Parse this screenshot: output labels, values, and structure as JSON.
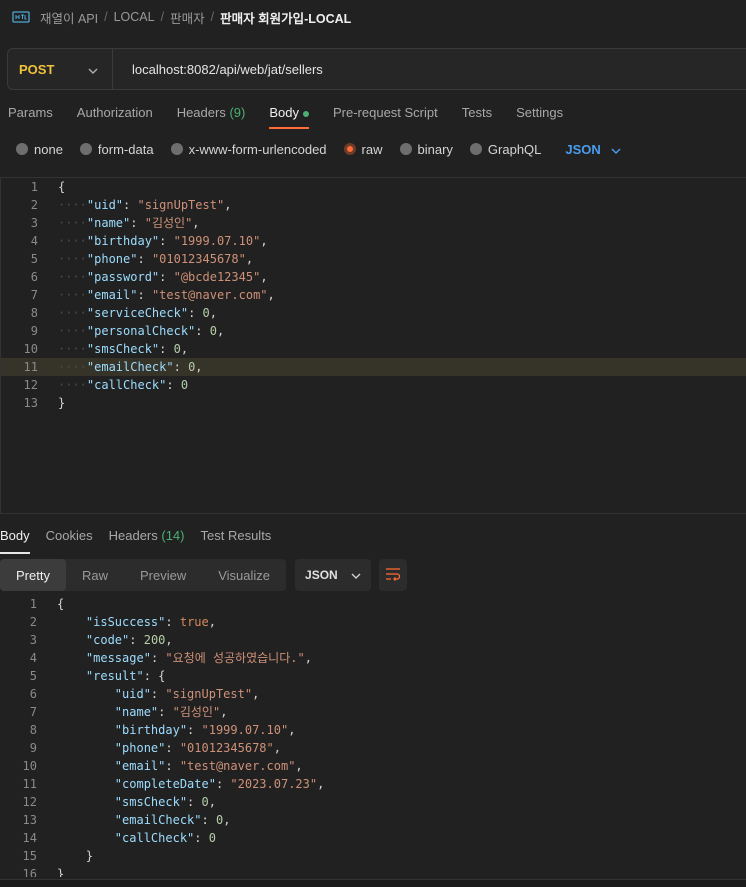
{
  "breadcrumb": {
    "parts": [
      "재열이 API",
      "LOCAL",
      "판매자"
    ],
    "separator": "/",
    "current": "판매자 회원가입-LOCAL"
  },
  "request": {
    "method": "POST",
    "url": "localhost:8082/api/web/jat/sellers"
  },
  "request_tabs": {
    "params": "Params",
    "authorization": "Authorization",
    "headers": "Headers",
    "headers_count": "(9)",
    "body": "Body",
    "prerequest": "Pre-request Script",
    "tests": "Tests",
    "settings": "Settings"
  },
  "body_types": {
    "none": "none",
    "form_data": "form-data",
    "urlencoded": "x-www-form-urlencoded",
    "raw": "raw",
    "binary": "binary",
    "graphql": "GraphQL",
    "language": "JSON"
  },
  "request_body": {
    "lines": [
      {
        "n": "1",
        "t": [
          [
            "p",
            "{"
          ]
        ]
      },
      {
        "n": "2",
        "t": [
          [
            "ws",
            "····"
          ],
          [
            "k",
            "\"uid\""
          ],
          [
            "p",
            ": "
          ],
          [
            "s",
            "\"signUpTest\""
          ],
          [
            "p",
            ","
          ]
        ]
      },
      {
        "n": "3",
        "t": [
          [
            "ws",
            "····"
          ],
          [
            "k",
            "\"name\""
          ],
          [
            "p",
            ": "
          ],
          [
            "s",
            "\"김성인\""
          ],
          [
            "p",
            ","
          ]
        ]
      },
      {
        "n": "4",
        "t": [
          [
            "ws",
            "····"
          ],
          [
            "k",
            "\"birthday\""
          ],
          [
            "p",
            ": "
          ],
          [
            "s",
            "\"1999.07.10\""
          ],
          [
            "p",
            ","
          ]
        ]
      },
      {
        "n": "5",
        "t": [
          [
            "ws",
            "····"
          ],
          [
            "k",
            "\"phone\""
          ],
          [
            "p",
            ": "
          ],
          [
            "s",
            "\"01012345678\""
          ],
          [
            "p",
            ","
          ]
        ]
      },
      {
        "n": "6",
        "t": [
          [
            "ws",
            "····"
          ],
          [
            "k",
            "\"password\""
          ],
          [
            "p",
            ": "
          ],
          [
            "s",
            "\"@bcde12345\""
          ],
          [
            "p",
            ","
          ]
        ]
      },
      {
        "n": "7",
        "t": [
          [
            "ws",
            "····"
          ],
          [
            "k",
            "\"email\""
          ],
          [
            "p",
            ": "
          ],
          [
            "s",
            "\"test@naver.com\""
          ],
          [
            "p",
            ","
          ]
        ]
      },
      {
        "n": "8",
        "t": [
          [
            "ws",
            "····"
          ],
          [
            "k",
            "\"serviceCheck\""
          ],
          [
            "p",
            ": "
          ],
          [
            "n",
            "0"
          ],
          [
            "p",
            ","
          ]
        ]
      },
      {
        "n": "9",
        "t": [
          [
            "ws",
            "····"
          ],
          [
            "k",
            "\"personalCheck\""
          ],
          [
            "p",
            ": "
          ],
          [
            "n",
            "0"
          ],
          [
            "p",
            ","
          ]
        ]
      },
      {
        "n": "10",
        "t": [
          [
            "ws",
            "····"
          ],
          [
            "k",
            "\"smsCheck\""
          ],
          [
            "p",
            ": "
          ],
          [
            "n",
            "0"
          ],
          [
            "p",
            ","
          ]
        ]
      },
      {
        "n": "11",
        "hl": true,
        "t": [
          [
            "ws",
            "····"
          ],
          [
            "k",
            "\"emailCheck\""
          ],
          [
            "p",
            ": "
          ],
          [
            "n",
            "0"
          ],
          [
            "p",
            ","
          ]
        ]
      },
      {
        "n": "12",
        "t": [
          [
            "ws",
            "····"
          ],
          [
            "k",
            "\"callCheck\""
          ],
          [
            "p",
            ": "
          ],
          [
            "n",
            "0"
          ]
        ]
      },
      {
        "n": "13",
        "t": [
          [
            "p",
            "}"
          ]
        ]
      }
    ]
  },
  "response_tabs": {
    "body": "Body",
    "cookies": "Cookies",
    "headers": "Headers",
    "headers_count": "(14)",
    "test_results": "Test Results"
  },
  "response_toolbar": {
    "pretty": "Pretty",
    "raw": "Raw",
    "preview": "Preview",
    "visualize": "Visualize",
    "format": "JSON"
  },
  "response_body": {
    "lines": [
      {
        "n": "1",
        "t": [
          [
            "p",
            "{"
          ]
        ]
      },
      {
        "n": "2",
        "t": [
          [
            "p",
            "    "
          ],
          [
            "k",
            "\"isSuccess\""
          ],
          [
            "p",
            ": "
          ],
          [
            "b",
            "true"
          ],
          [
            "p",
            ","
          ]
        ]
      },
      {
        "n": "3",
        "t": [
          [
            "p",
            "    "
          ],
          [
            "k",
            "\"code\""
          ],
          [
            "p",
            ": "
          ],
          [
            "n",
            "200"
          ],
          [
            "p",
            ","
          ]
        ]
      },
      {
        "n": "4",
        "t": [
          [
            "p",
            "    "
          ],
          [
            "k",
            "\"message\""
          ],
          [
            "p",
            ": "
          ],
          [
            "s",
            "\"요청에 성공하였습니다.\""
          ],
          [
            "p",
            ","
          ]
        ]
      },
      {
        "n": "5",
        "t": [
          [
            "p",
            "    "
          ],
          [
            "k",
            "\"result\""
          ],
          [
            "p",
            ": {"
          ]
        ]
      },
      {
        "n": "6",
        "t": [
          [
            "p",
            "        "
          ],
          [
            "k",
            "\"uid\""
          ],
          [
            "p",
            ": "
          ],
          [
            "s",
            "\"signUpTest\""
          ],
          [
            "p",
            ","
          ]
        ]
      },
      {
        "n": "7",
        "t": [
          [
            "p",
            "        "
          ],
          [
            "k",
            "\"name\""
          ],
          [
            "p",
            ": "
          ],
          [
            "s",
            "\"김성인\""
          ],
          [
            "p",
            ","
          ]
        ]
      },
      {
        "n": "8",
        "t": [
          [
            "p",
            "        "
          ],
          [
            "k",
            "\"birthday\""
          ],
          [
            "p",
            ": "
          ],
          [
            "s",
            "\"1999.07.10\""
          ],
          [
            "p",
            ","
          ]
        ]
      },
      {
        "n": "9",
        "t": [
          [
            "p",
            "        "
          ],
          [
            "k",
            "\"phone\""
          ],
          [
            "p",
            ": "
          ],
          [
            "s",
            "\"01012345678\""
          ],
          [
            "p",
            ","
          ]
        ]
      },
      {
        "n": "10",
        "t": [
          [
            "p",
            "        "
          ],
          [
            "k",
            "\"email\""
          ],
          [
            "p",
            ": "
          ],
          [
            "s",
            "\"test@naver.com\""
          ],
          [
            "p",
            ","
          ]
        ]
      },
      {
        "n": "11",
        "t": [
          [
            "p",
            "        "
          ],
          [
            "k",
            "\"completeDate\""
          ],
          [
            "p",
            ": "
          ],
          [
            "s",
            "\"2023.07.23\""
          ],
          [
            "p",
            ","
          ]
        ]
      },
      {
        "n": "12",
        "t": [
          [
            "p",
            "        "
          ],
          [
            "k",
            "\"smsCheck\""
          ],
          [
            "p",
            ": "
          ],
          [
            "n",
            "0"
          ],
          [
            "p",
            ","
          ]
        ]
      },
      {
        "n": "13",
        "t": [
          [
            "p",
            "        "
          ],
          [
            "k",
            "\"emailCheck\""
          ],
          [
            "p",
            ": "
          ],
          [
            "n",
            "0"
          ],
          [
            "p",
            ","
          ]
        ]
      },
      {
        "n": "14",
        "t": [
          [
            "p",
            "        "
          ],
          [
            "k",
            "\"callCheck\""
          ],
          [
            "p",
            ": "
          ],
          [
            "n",
            "0"
          ]
        ]
      },
      {
        "n": "15",
        "t": [
          [
            "p",
            "    }"
          ]
        ]
      },
      {
        "n": "16",
        "t": [
          [
            "p",
            "}"
          ]
        ]
      }
    ]
  },
  "colors": {
    "accent": "#ff6c37",
    "method_post": "#f0c23b",
    "link_blue": "#4a9eef",
    "success_green": "#4caf72"
  }
}
